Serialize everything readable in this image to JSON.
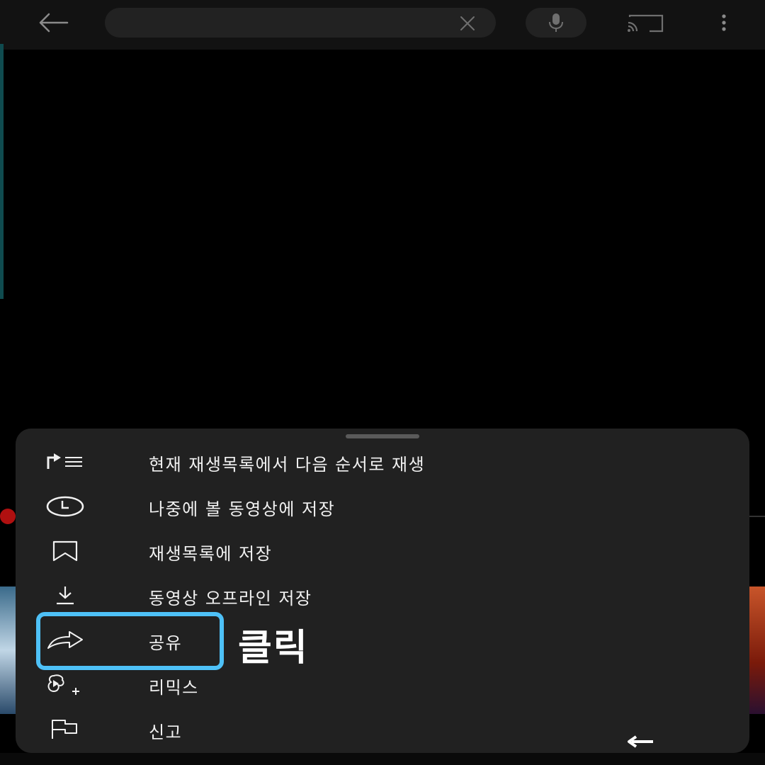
{
  "topbar": {
    "back_icon": "back-arrow-icon",
    "search": {
      "value": "",
      "placeholder": ""
    },
    "clear_icon": "close-icon",
    "mic_icon": "microphone-icon",
    "cast_icon": "cast-icon",
    "more_icon": "more-vert-icon"
  },
  "menu": {
    "items": [
      {
        "icon": "play-next-icon",
        "label": "현재 재생목록에서 다음 순서로 재생"
      },
      {
        "icon": "clock-icon",
        "label": "나중에 볼 동영상에 저장"
      },
      {
        "icon": "bookmark-icon",
        "label": "재생목록에 저장"
      },
      {
        "icon": "download-icon",
        "label": "동영상 오프라인 저장"
      },
      {
        "icon": "share-icon",
        "label": "공유"
      },
      {
        "icon": "remix-icon",
        "label": "리믹스"
      },
      {
        "icon": "flag-icon",
        "label": "신고"
      }
    ]
  },
  "annotation": {
    "click_text": "클릭",
    "highlight_color": "#4ec1f7"
  },
  "colors": {
    "sheet_bg": "#212121",
    "topbar_bg": "#121212",
    "text": "#f1f1f1"
  }
}
